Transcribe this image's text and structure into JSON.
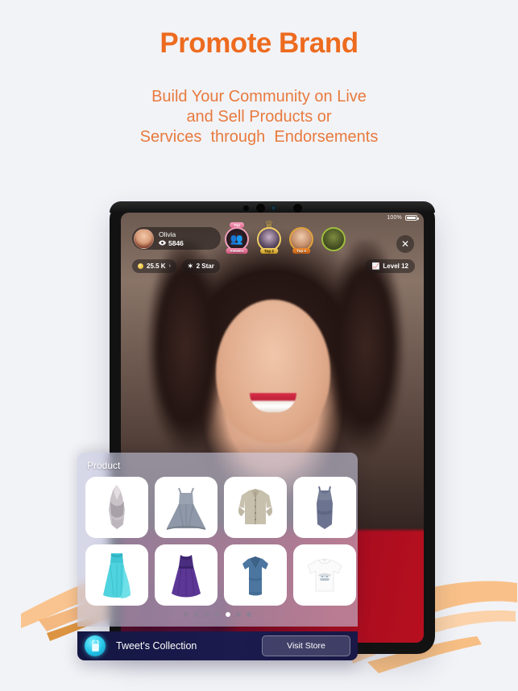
{
  "hero": {
    "title": "Promote Brand",
    "subtitle_lines": [
      "Build Your Community on Live",
      "and Sell Products or",
      "Services  through  Endorsements"
    ],
    "title_color": "#ED6B1F",
    "subtitle_color": "#E87A3E",
    "background_color": "#f2f3f7",
    "accent_brush_color": "#F7B267"
  },
  "device": {
    "frame_color": "#121212",
    "status": {
      "battery_percent": "100%"
    }
  },
  "live": {
    "host": {
      "name": "Olivia",
      "viewers": "5846",
      "viewers_icon": "eye-icon"
    },
    "close_icon": "close-icon",
    "stats": [
      {
        "icon": "coin-icon",
        "label": "25.5 K",
        "chevron": "›"
      },
      {
        "icon": "star-icon",
        "label": "2 Star"
      }
    ],
    "level": {
      "icon": "chart-line-icon",
      "label": "Level 12"
    },
    "top_viewers": [
      {
        "badge_top": "Top",
        "badge": "Viewers",
        "icon": "viewers-group-icon"
      },
      {
        "badge": "Top 2",
        "crown": "crown-icon"
      },
      {
        "badge": "Top 3"
      },
      {
        "badge": ""
      }
    ]
  },
  "product_panel": {
    "title": "Product",
    "items": [
      {
        "name": "silver-halter-dress",
        "alt": "Silver halter mini dress"
      },
      {
        "name": "grey-flare-dress",
        "alt": "Grey sleeveless flare dress"
      },
      {
        "name": "beige-shirt-dress",
        "alt": "Beige button shirt dress"
      },
      {
        "name": "navy-tank-dress",
        "alt": "Navy sleeveless dress"
      },
      {
        "name": "teal-gown",
        "alt": "Teal long evening gown"
      },
      {
        "name": "purple-gown",
        "alt": "Purple lace evening gown"
      },
      {
        "name": "denim-vneck-dress",
        "alt": "Blue denim v-neck dress"
      },
      {
        "name": "white-print-tshirt",
        "alt": "White printed t-shirt"
      }
    ],
    "pager": {
      "count": 7,
      "active_index": 4
    }
  },
  "store_bar": {
    "icon": "shopping-bag-icon",
    "name": "Tweet's Collection",
    "button_label": "Visit Store"
  }
}
